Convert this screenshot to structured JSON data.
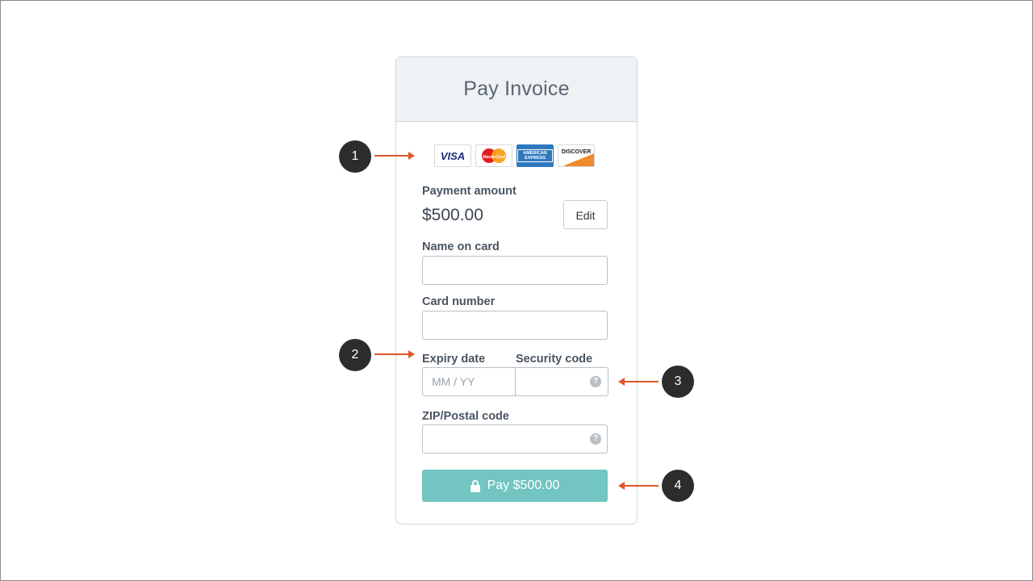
{
  "form": {
    "title": "Pay Invoice",
    "card_logos": [
      {
        "name": "visa-logo",
        "label": "VISA"
      },
      {
        "name": "mastercard-logo",
        "label": "MasterCard"
      },
      {
        "name": "amex-logo",
        "label": "AMERICAN EXPRESS"
      },
      {
        "name": "discover-logo",
        "label": "DISCOVER"
      }
    ],
    "payment_amount_label": "Payment amount",
    "payment_amount": "$500.00",
    "edit_label": "Edit",
    "name_label": "Name on card",
    "name_value": "",
    "card_number_label": "Card number",
    "card_number_value": "",
    "expiry_label": "Expiry date",
    "expiry_placeholder": "MM / YY",
    "security_label": "Security code",
    "zip_label": "ZIP/Postal code",
    "help_icon": "?",
    "pay_label": "Pay $500.00",
    "pay_icon": "lock-icon"
  },
  "annotations": [
    {
      "label": "1",
      "direction": "right"
    },
    {
      "label": "2",
      "direction": "right"
    },
    {
      "label": "3",
      "direction": "left"
    },
    {
      "label": "4",
      "direction": "left"
    }
  ],
  "colors": {
    "accent_arrow": "#e0572b",
    "pay_button": "#72c5c0",
    "header_bg": "#eef2f5",
    "marker_bg": "#2c2c2c"
  }
}
